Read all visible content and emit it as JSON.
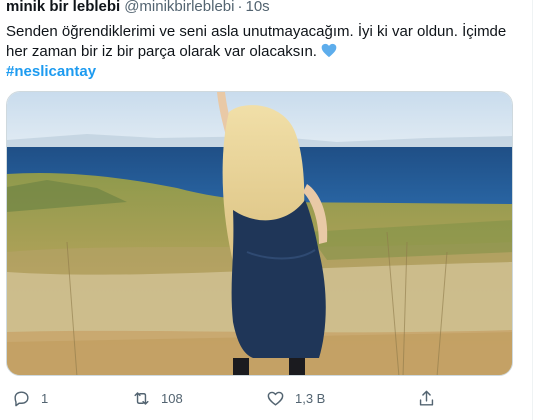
{
  "tweet": {
    "display_name": "minik bir leblebi",
    "handle": "@minikbirleblebi",
    "separator": "·",
    "time": "10s",
    "text_line1": "Senden öğrendiklerimi ve seni asla unutmayacağım. İyi ki var oldun. İçimde",
    "text_line2": "her zaman bir iz bir parça olarak var olacaksın.",
    "emoji": "blue-heart",
    "hashtag": "#neslicantay",
    "media_description": "Woman with long blonde hair in a denim dress, arm raised, standing in a grassy field facing the sea"
  },
  "actions": {
    "replies": "1",
    "retweets": "108",
    "likes": "1,3 B"
  },
  "icons": {
    "reply": "reply-icon",
    "retweet": "retweet-icon",
    "like": "heart-icon",
    "views": "views-icon",
    "share": "share-icon"
  },
  "colors": {
    "text": "#0f1419",
    "secondary": "#536471",
    "accent": "#1d9bf0",
    "heart_emoji": "#5dadec"
  }
}
